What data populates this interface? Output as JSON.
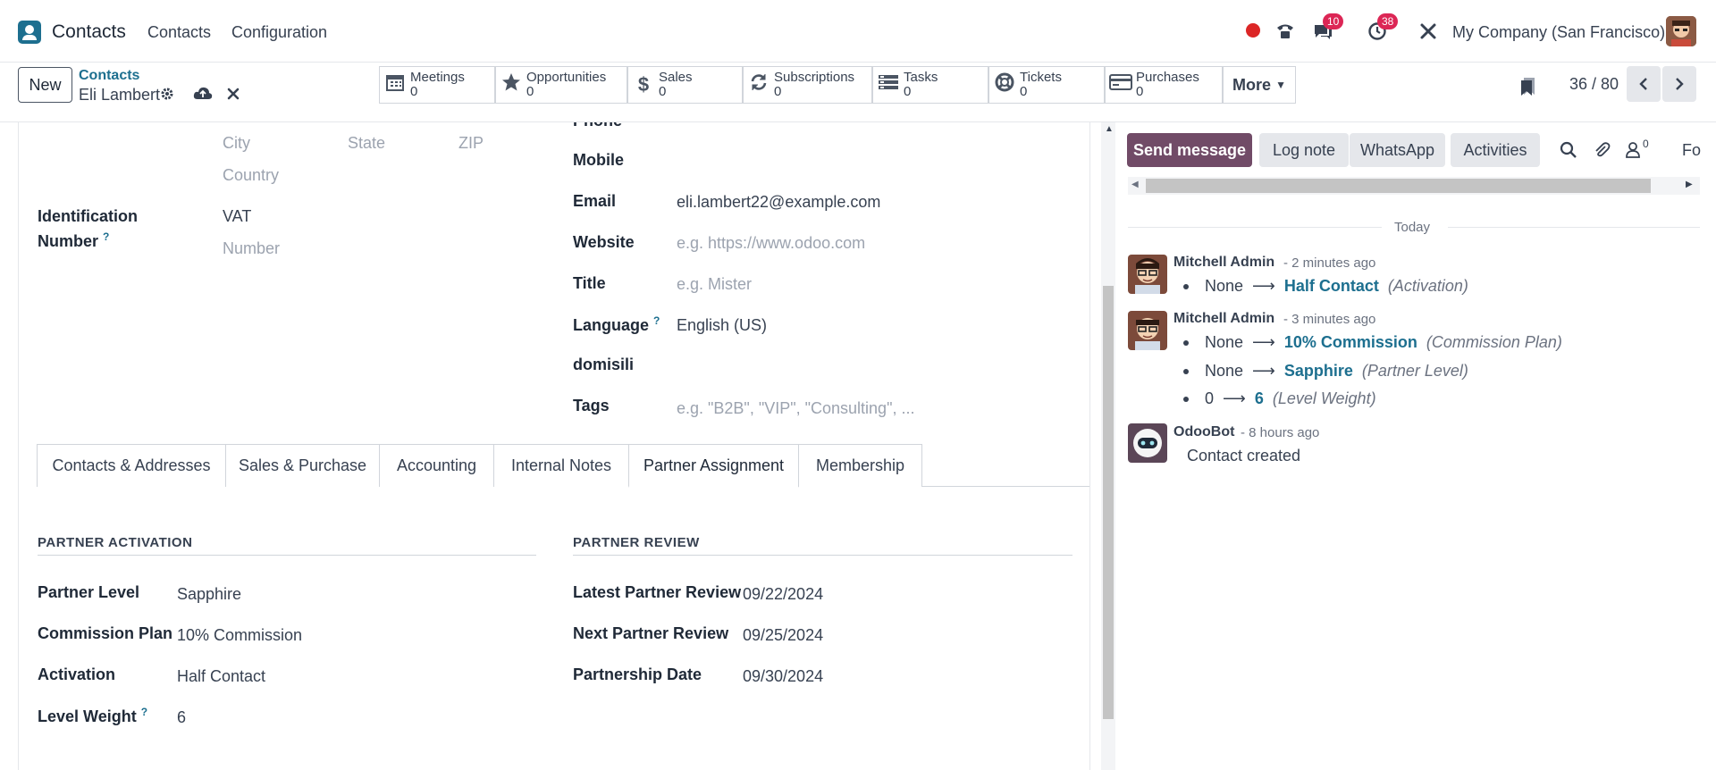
{
  "topbar": {
    "app_name": "Contacts",
    "menu": [
      "Contacts",
      "Configuration"
    ],
    "messages_badge": "10",
    "activities_badge": "38",
    "company": "My Company (San Francisco)"
  },
  "control": {
    "new_label": "New",
    "breadcrumb_parent": "Contacts",
    "breadcrumb_current": "Eli Lambert",
    "smart_buttons": [
      {
        "label": "Meetings",
        "count": "0",
        "icon": "calendar-icon"
      },
      {
        "label": "Opportunities",
        "count": "0",
        "icon": "star-icon"
      },
      {
        "label": "Sales",
        "count": "0",
        "icon": "dollar-icon"
      },
      {
        "label": "Subscriptions",
        "count": "0",
        "icon": "refresh-icon"
      },
      {
        "label": "Tasks",
        "count": "0",
        "icon": "tasks-icon"
      },
      {
        "label": "Tickets",
        "count": "0",
        "icon": "lifebuoy-icon"
      },
      {
        "label": "Purchases",
        "count": "0",
        "icon": "credit-card-icon"
      }
    ],
    "more_label": "More",
    "pager": "36 / 80"
  },
  "form": {
    "address": {
      "city_ph": "City",
      "state_ph": "State",
      "zip_ph": "ZIP",
      "country_ph": "Country"
    },
    "identification_label_1": "Identification",
    "identification_label_2": "Number",
    "vat": "VAT",
    "number_ph": "Number",
    "phone_label": "Phone",
    "mobile_label": "Mobile",
    "email_label": "Email",
    "email_value": "eli.lambert22@example.com",
    "website_label": "Website",
    "website_ph": "e.g. https://www.odoo.com",
    "title_label": "Title",
    "title_ph": "e.g. Mister",
    "language_label": "Language",
    "language_value": "English (US)",
    "domisili_label": "domisili",
    "tags_label": "Tags",
    "tags_ph": "e.g. \"B2B\", \"VIP\", \"Consulting\", ...",
    "help_mark": "?"
  },
  "tabs": [
    "Contacts & Addresses",
    "Sales & Purchase",
    "Accounting",
    "Internal Notes",
    "Partner Assignment",
    "Membership"
  ],
  "active_tab": "Partner Assignment",
  "partner_activation": {
    "title": "PARTNER ACTIVATION",
    "level_label": "Partner Level",
    "level_value": "Sapphire",
    "commission_label": "Commission Plan",
    "commission_value": "10% Commission",
    "activation_label": "Activation",
    "activation_value": "Half Contact",
    "weight_label": "Level Weight",
    "weight_value": "6"
  },
  "partner_review": {
    "title": "PARTNER REVIEW",
    "latest_label": "Latest Partner Review",
    "latest_value": "09/22/2024",
    "next_label": "Next Partner Review",
    "next_value": "09/25/2024",
    "date_label": "Partnership Date",
    "date_value": "09/30/2024"
  },
  "chatter": {
    "send_message": "Send message",
    "log_note": "Log note",
    "whatsapp": "WhatsApp",
    "activities": "Activities",
    "followers_count": "0",
    "follow_cut": "Fo",
    "today": "Today",
    "messages": [
      {
        "author": "Mitchell Admin",
        "when": "- 2 minutes ago",
        "tracking": [
          {
            "old": "None",
            "new": "Half Contact",
            "field": "(Activation)"
          }
        ]
      },
      {
        "author": "Mitchell Admin",
        "when": "- 3 minutes ago",
        "tracking": [
          {
            "old": "None",
            "new": "10% Commission",
            "field": "(Commission Plan)"
          },
          {
            "old": "None",
            "new": "Sapphire",
            "field": "(Partner Level)"
          },
          {
            "old": "0",
            "new": "6",
            "field": "(Level Weight)"
          }
        ]
      },
      {
        "author": "OdooBot",
        "when": "- 8 hours ago",
        "body": "Contact created"
      }
    ]
  }
}
